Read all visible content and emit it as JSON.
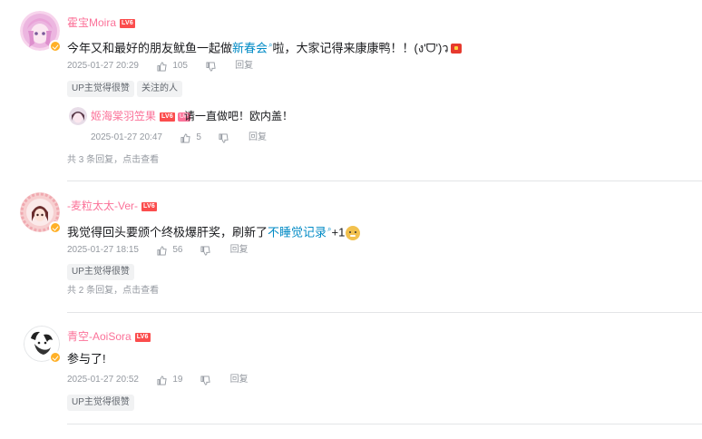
{
  "comments": [
    {
      "username": "霍宝Moira",
      "level": "LV6",
      "text_before": "今年又和最好的朋友鱿鱼一起做",
      "link_text": "新春会",
      "text_after": "啦，大家记得来康康鸭！！(ง'ᗜ')ว",
      "time": "2025-01-27 20:29",
      "likes": "105",
      "reply_label": "回复",
      "tags": [
        "UP主觉得很赞",
        "关注的人"
      ],
      "sub_reply": {
        "username": "姬海棠羽笠果",
        "level": "LV6",
        "up_badge": "UP",
        "text": "请一直做吧！欧内盖！",
        "time": "2025-01-27 20:47",
        "likes": "5",
        "reply_label": "回复"
      },
      "replies_summary": "共 3 条回复，点击查看"
    },
    {
      "username": "-麦粒太太-Ver-",
      "level": "LV6",
      "text_before": "我觉得回头要颁个终极爆肝奖，刷新了",
      "link_text": "不睡觉记录",
      "text_after": "+1",
      "time": "2025-01-27 18:15",
      "likes": "56",
      "reply_label": "回复",
      "tags": [
        "UP主觉得很赞"
      ],
      "replies_summary": "共 2 条回复，点击查看"
    },
    {
      "username": "青空-AoiSora",
      "level": "LV6",
      "text": "参与了!",
      "time": "2025-01-27 20:52",
      "likes": "19",
      "reply_label": "回复",
      "tags": [
        "UP主觉得很赞"
      ]
    }
  ],
  "colors": {
    "username_pink": "#fb7299",
    "link_blue": "#008ac5",
    "meta_gray": "#9499a0",
    "level_badge": "#fb4d4d"
  }
}
